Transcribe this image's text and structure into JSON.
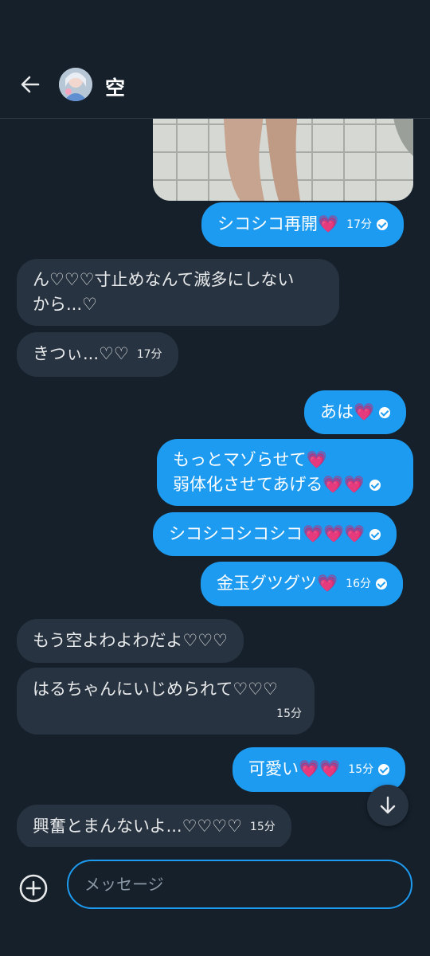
{
  "header": {
    "back_icon": "arrow-left-icon",
    "title": "空"
  },
  "messages": [
    {
      "dir": "out",
      "text": "シコシコ再開",
      "hearts": "💗",
      "time": "17分",
      "read": true
    },
    {
      "dir": "in",
      "line1": "ん♡♡♡寸止めなんて滅多にしない",
      "line2": "から...♡"
    },
    {
      "dir": "in",
      "text": "きつぃ...♡♡",
      "time": "17分"
    },
    {
      "dir": "out",
      "text": "あは",
      "hearts": "💗",
      "read": true
    },
    {
      "dir": "out",
      "line1": "もっとマゾらせて",
      "line1_hearts": "💗",
      "line2": "弱体化させてあげる",
      "line2_hearts": "💗💗",
      "read": true
    },
    {
      "dir": "out",
      "text": "シコシコシコシコ",
      "hearts": "💗💗💗",
      "read": true
    },
    {
      "dir": "out",
      "text": "金玉グツグツ",
      "hearts": "💗",
      "time": "16分",
      "read": true
    },
    {
      "dir": "in",
      "text": "もう空よわよわだよ♡♡♡"
    },
    {
      "dir": "in",
      "text": "はるちゃんにいじめられて♡♡♡",
      "time": "15分"
    },
    {
      "dir": "out",
      "text": "可愛い",
      "hearts": "💗💗",
      "time": "15分",
      "read": true
    },
    {
      "dir": "in",
      "text": "興奮とまんないよ...♡♡♡♡",
      "time": "15分"
    }
  ],
  "composer": {
    "placeholder": "メッセージ",
    "add_icon": "plus-circle-icon"
  },
  "scroll_icon": "arrow-down-icon",
  "colors": {
    "background": "#15202b",
    "outgoing_bubble": "#1d9bf0",
    "incoming_bubble": "#273340",
    "heart": "#ff9ec7"
  }
}
